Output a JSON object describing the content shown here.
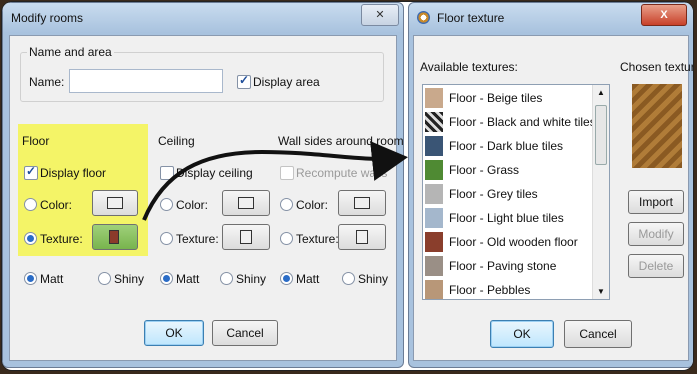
{
  "modify_rooms": {
    "title": "Modify rooms",
    "close_glyph": "✕",
    "name_area": {
      "group_label": "Name and area",
      "name_label": "Name:",
      "name_value": "",
      "display_area_label": "Display area",
      "display_area_checked": true
    },
    "floor": {
      "label": "Floor",
      "display_label": "Display floor",
      "display_checked": true,
      "color_label": "Color:",
      "texture_label": "Texture:",
      "texture_selected": true,
      "matt_label": "Matt",
      "shiny_label": "Shiny",
      "matt_selected": true,
      "texture_swatch_color": "#8b3b2a",
      "highlight_color": "#f4f467"
    },
    "ceiling": {
      "label": "Ceiling",
      "display_label": "Display ceiling",
      "display_checked": false,
      "color_label": "Color:",
      "texture_label": "Texture:",
      "matt_label": "Matt",
      "shiny_label": "Shiny",
      "matt_selected": true
    },
    "walls": {
      "label": "Wall sides around room",
      "recompute_label": "Recompute walls",
      "recompute_enabled": false,
      "color_label": "Color:",
      "texture_label": "Texture:",
      "matt_label": "Matt",
      "shiny_label": "Shiny",
      "matt_selected": true
    },
    "ok_label": "OK",
    "cancel_label": "Cancel"
  },
  "floor_texture": {
    "title": "Floor texture",
    "close_glyph": "X",
    "available_label": "Available textures:",
    "chosen_label": "Chosen texture:",
    "textures": [
      {
        "label": "Floor - Beige tiles",
        "color": "#c9a98c"
      },
      {
        "label": "Floor - Black and white tiles",
        "color": "#6e6e6e"
      },
      {
        "label": "Floor - Dark blue tiles",
        "color": "#3a5575"
      },
      {
        "label": "Floor - Grass",
        "color": "#4f8a33"
      },
      {
        "label": "Floor - Grey tiles",
        "color": "#b5b5b5"
      },
      {
        "label": "Floor - Light blue tiles",
        "color": "#a4b7cc"
      },
      {
        "label": "Floor - Old wooden floor",
        "color": "#8a3e2c"
      },
      {
        "label": "Floor - Paving stone",
        "color": "#9a8f86"
      },
      {
        "label": "Floor - Pebbles",
        "color": "#b89778"
      }
    ],
    "chosen_color": "#9b6a2c",
    "import_label": "Import",
    "modify_label": "Modify",
    "delete_label": "Delete",
    "ok_label": "OK",
    "cancel_label": "Cancel"
  }
}
